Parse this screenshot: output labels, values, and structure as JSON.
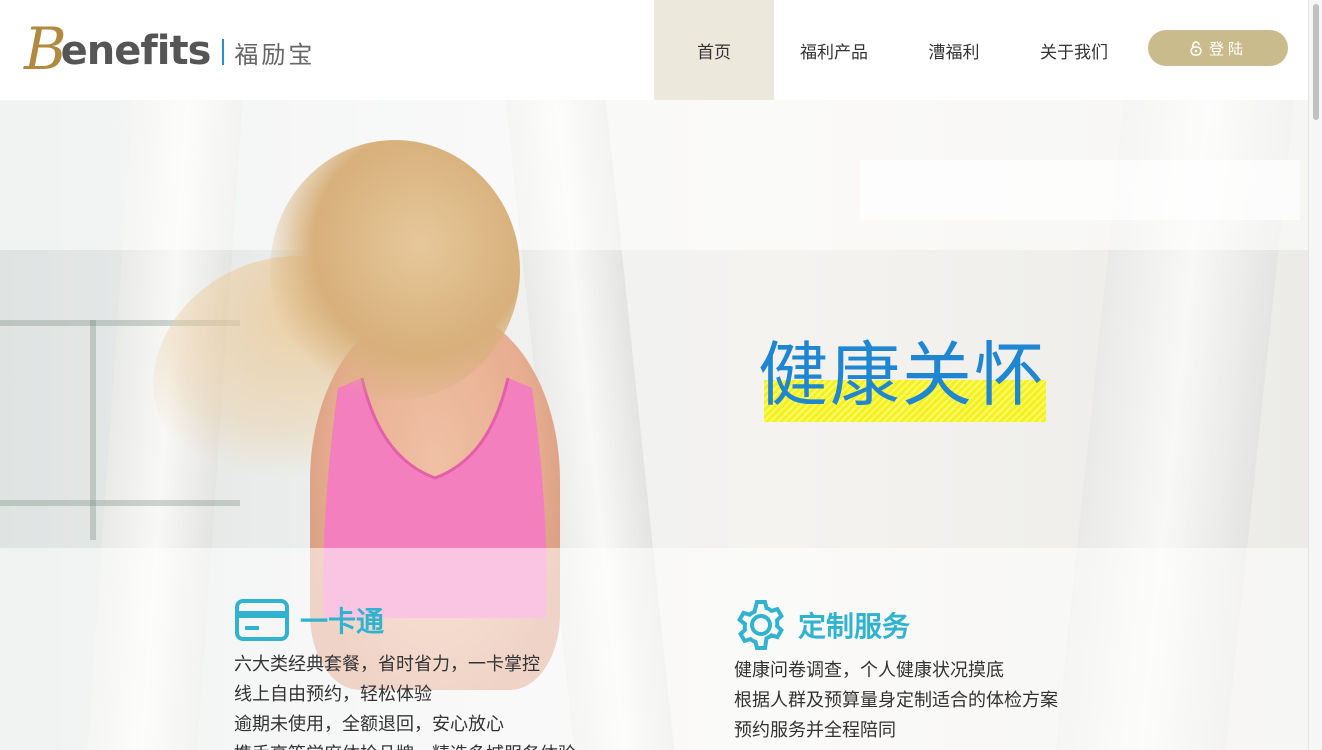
{
  "logo": {
    "wordmark_initial": "B",
    "wordmark_rest": "enefits",
    "chinese_name": "福励宝"
  },
  "nav": {
    "items": [
      {
        "label": "首页",
        "active": true
      },
      {
        "label": "福利产品",
        "active": false
      },
      {
        "label": "漕福利",
        "active": false
      },
      {
        "label": "关于我们",
        "active": false
      }
    ],
    "login_label": "登陆",
    "login_icon": "lock-icon"
  },
  "hero": {
    "headline": "健康关怀",
    "headline_color": "#1f86d1",
    "highlight_color": "#f5f21b"
  },
  "features": [
    {
      "icon": "card-icon",
      "title": "一卡通",
      "lines": [
        "六大类经典套餐，省时省力，一卡掌控",
        "线上自由预约，轻松体验",
        "逾期未使用，全额退回，安心放心",
        "携手高等学府体检品牌，精选多城服务体验"
      ]
    },
    {
      "icon": "gear-icon",
      "title": "定制服务",
      "lines": [
        "健康问卷调查，个人健康状况摸底",
        "根据人群及预算量身定制适合的体检方案",
        "预约服务并全程陪同"
      ]
    }
  ],
  "colors": {
    "accent_gold": "#c9bb8c",
    "feature_teal": "#31b3d0",
    "nav_active_bg": "#ece8dc"
  }
}
